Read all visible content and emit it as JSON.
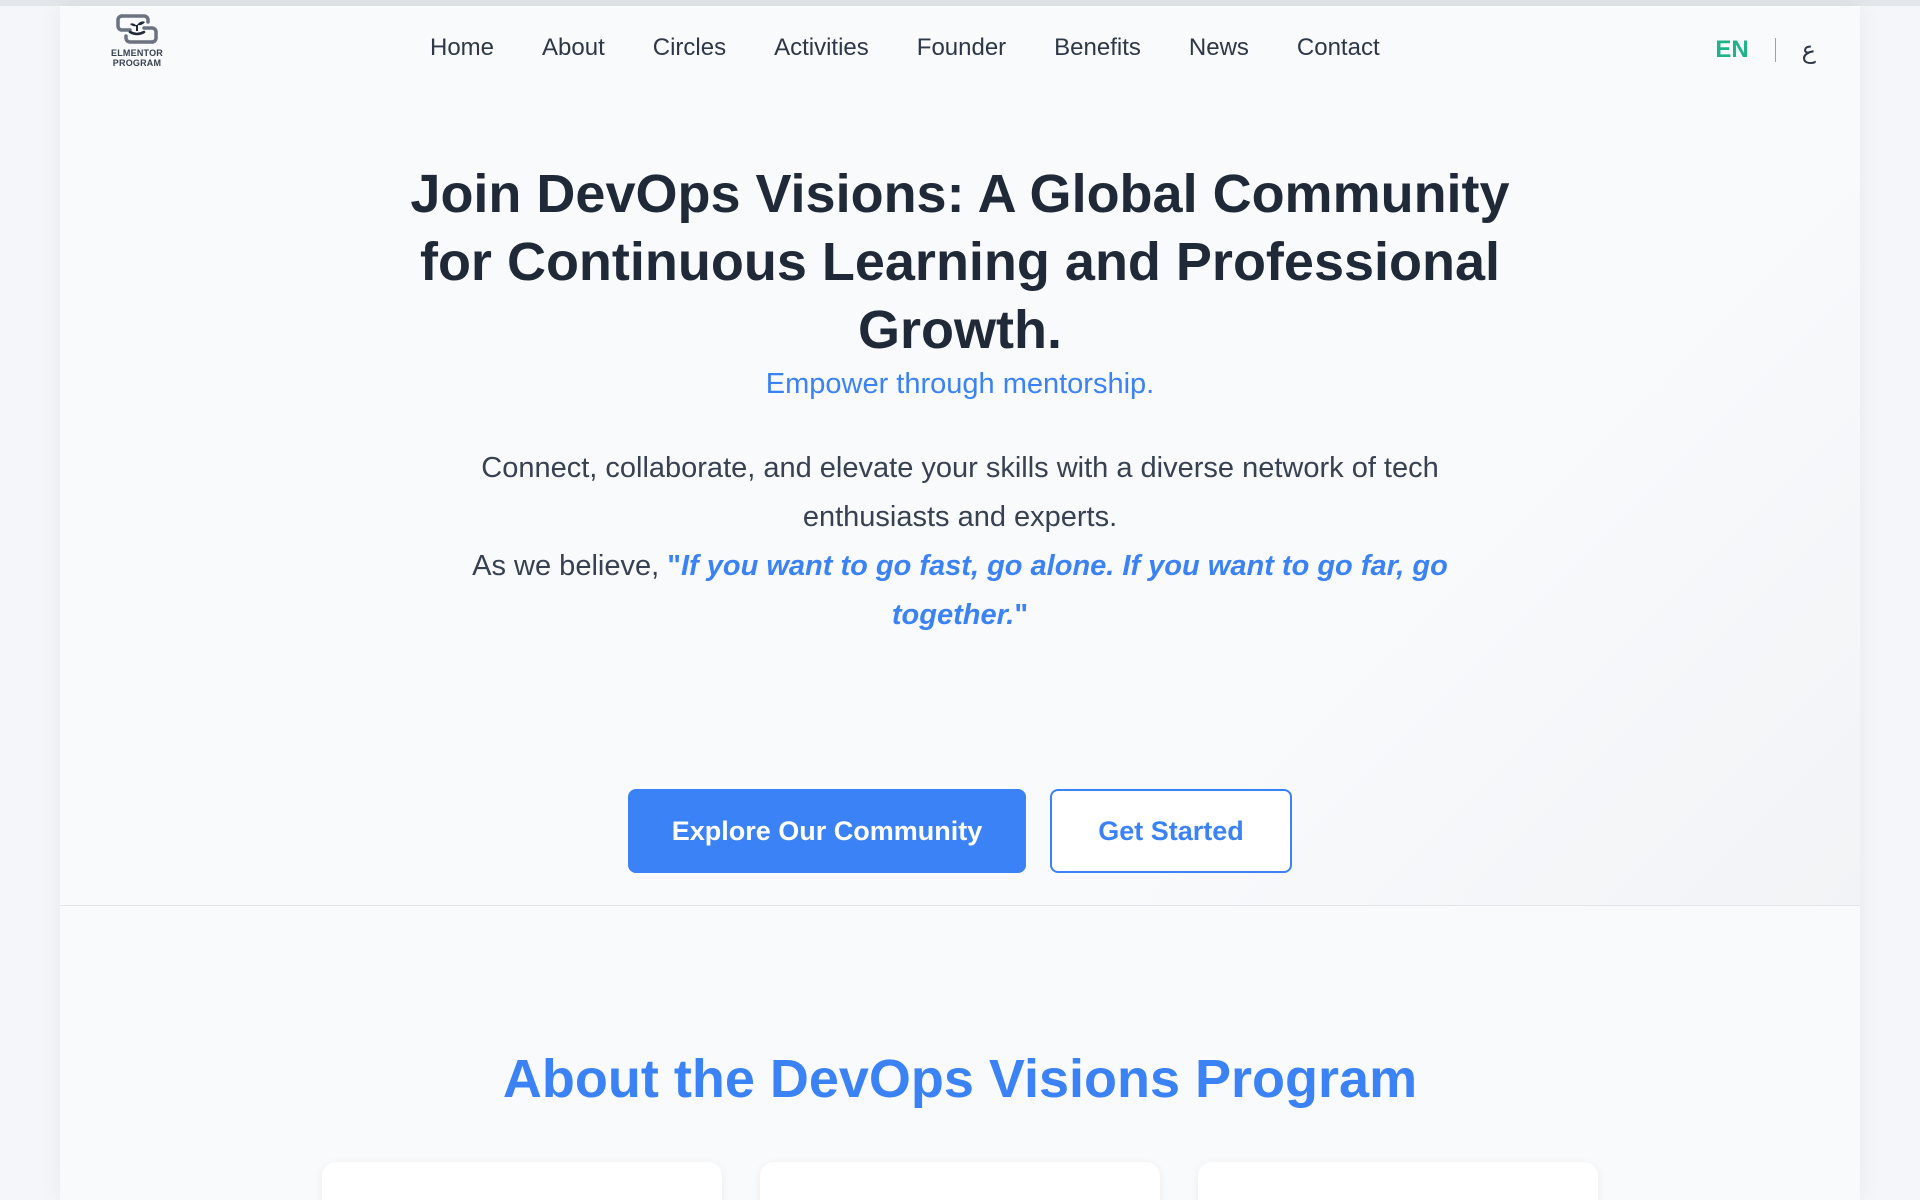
{
  "brand": {
    "logo_line1": "ELMENTOR",
    "logo_line2": "PROGRAM",
    "logo_icon": "hands-sprout-icon"
  },
  "nav": {
    "items": [
      {
        "label": "Home"
      },
      {
        "label": "About"
      },
      {
        "label": "Circles"
      },
      {
        "label": "Activities"
      },
      {
        "label": "Founder"
      },
      {
        "label": "Benefits"
      },
      {
        "label": "News"
      },
      {
        "label": "Contact"
      }
    ]
  },
  "language": {
    "current": "EN",
    "alternate": "ع"
  },
  "hero": {
    "title": "Join DevOps Visions: A Global Community for Continuous Learning and Professional Growth.",
    "tagline": "Empower through mentorship.",
    "description": "Connect, collaborate, and elevate your skills with a diverse network of tech enthusiasts and experts.",
    "quote_intro": "As we believe,",
    "quote_open": "\"",
    "quote": "If you want to go fast, go alone. If you want to go far, go together.",
    "quote_close": "\"",
    "primary_cta": "Explore Our Community",
    "secondary_cta": "Get Started"
  },
  "about": {
    "title": "About the DevOps Visions Program"
  },
  "colors": {
    "accent": "#3b82f6",
    "language_active": "#1fb38a",
    "heading": "#1f2937",
    "background": "#f8fafc"
  }
}
